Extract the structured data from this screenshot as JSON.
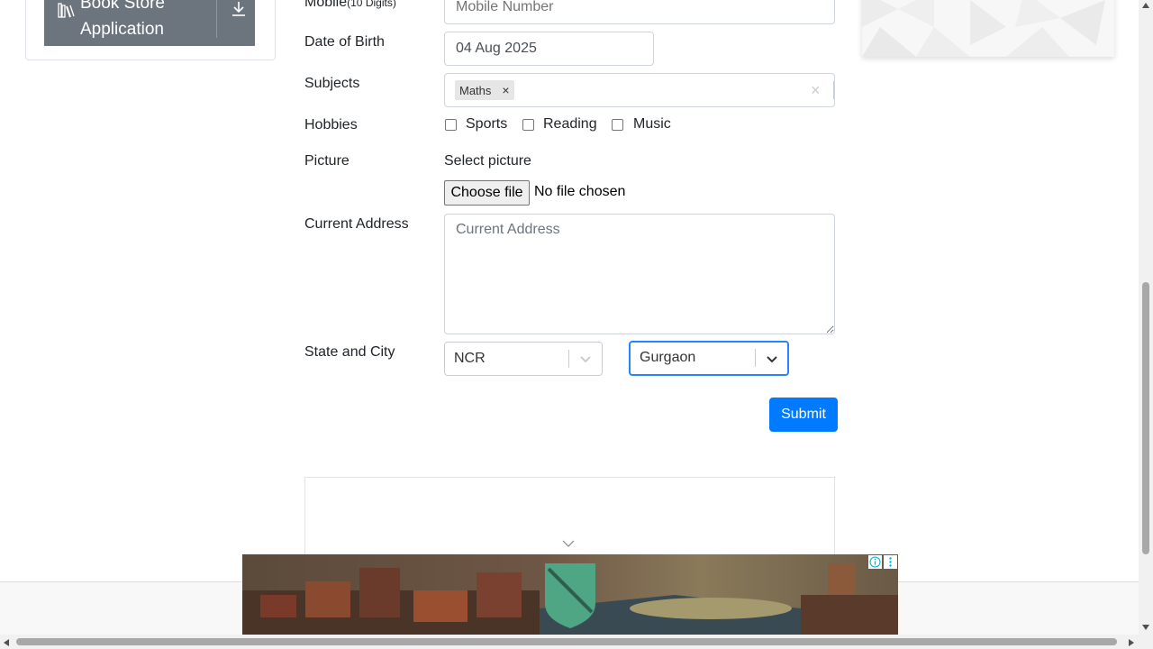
{
  "sidebar": {
    "book_store": {
      "label": "Book Store Application",
      "icon": "books-icon",
      "action_icon": "download-icon"
    }
  },
  "form": {
    "mobile": {
      "label": "Mobile",
      "hint": "(10 Digits)",
      "placeholder": "Mobile Number"
    },
    "dob": {
      "label": "Date of Birth",
      "value": "04 Aug 2025"
    },
    "subjects": {
      "label": "Subjects",
      "chips": [
        "Maths"
      ],
      "chip_remove": "×",
      "clear": "×"
    },
    "hobbies": {
      "label": "Hobbies",
      "options": [
        "Sports",
        "Reading",
        "Music"
      ],
      "checked": [
        false,
        false,
        false
      ]
    },
    "picture": {
      "label": "Picture",
      "prompt": "Select picture",
      "button": "Choose file",
      "status": "No file chosen"
    },
    "address": {
      "label": "Current Address",
      "placeholder": "Current Address"
    },
    "state_city": {
      "label": "State and City",
      "state": "NCR",
      "city": "Gurgaon"
    },
    "submit": "Submit"
  },
  "colors": {
    "primary": "#007bff",
    "sidebar_item": "#6c757d",
    "focus_border": "#2684ff",
    "banner_shield": "#4fa685"
  }
}
